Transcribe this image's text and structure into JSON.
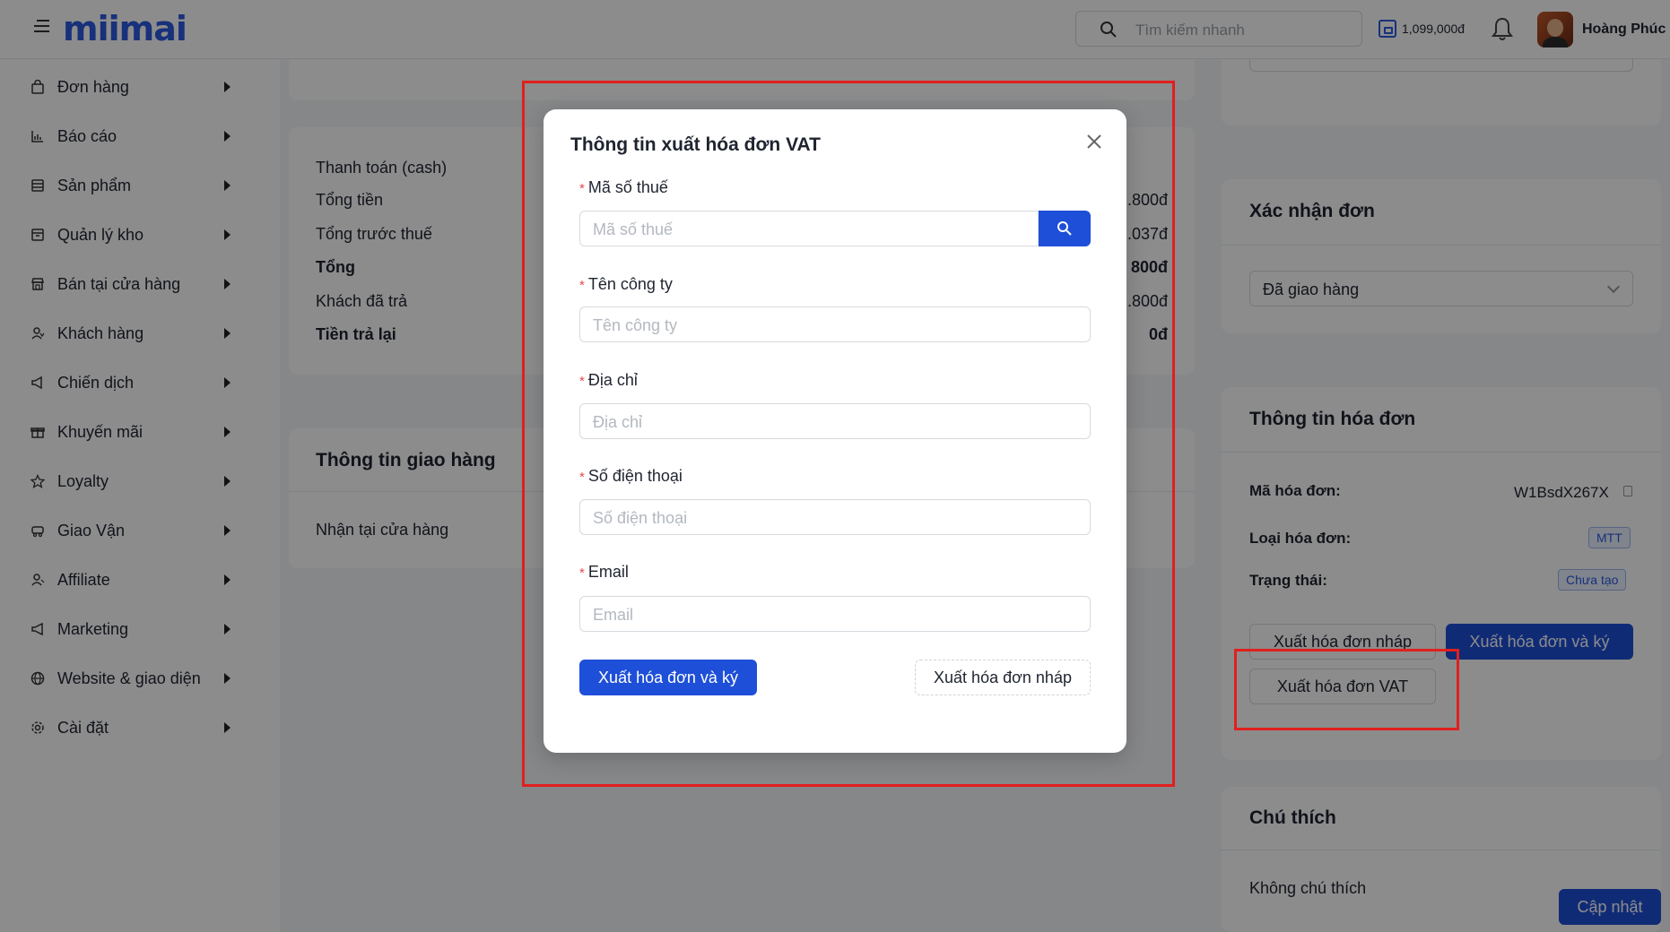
{
  "header": {
    "logo": "miimai",
    "search_placeholder": "Tìm kiếm nhanh",
    "balance": "1,099,000đ",
    "user_name": "Hoàng Phúc"
  },
  "sidebar": {
    "items": [
      {
        "label": "Đơn hàng",
        "icon": "bag-icon"
      },
      {
        "label": "Báo cáo",
        "icon": "chart-icon"
      },
      {
        "label": "Sản phẩm",
        "icon": "box-icon"
      },
      {
        "label": "Quản lý kho",
        "icon": "warehouse-icon"
      },
      {
        "label": "Bán tại cửa hàng",
        "icon": "store-icon"
      },
      {
        "label": "Khách hàng",
        "icon": "customer-icon"
      },
      {
        "label": "Chiến dịch",
        "icon": "megaphone-icon"
      },
      {
        "label": "Khuyến mãi",
        "icon": "gift-icon"
      },
      {
        "label": "Loyalty",
        "icon": "star-icon"
      },
      {
        "label": "Giao Vận",
        "icon": "truck-icon"
      },
      {
        "label": "Affiliate",
        "icon": "affiliate-icon"
      },
      {
        "label": "Marketing",
        "icon": "marketing-icon"
      },
      {
        "label": "Website & giao diện",
        "icon": "globe-icon"
      },
      {
        "label": "Cài đặt",
        "icon": "gear-icon"
      }
    ]
  },
  "payment": {
    "rows": [
      {
        "label": "Thanh toán (cash)",
        "value": "",
        "bold": false
      },
      {
        "label": "Tổng tiền",
        "value": ".800đ",
        "bold": false
      },
      {
        "label": "Tổng trước thuế",
        "value": ".037đ",
        "bold": false
      },
      {
        "label": "Tổng",
        "value": "800đ",
        "bold": true
      },
      {
        "label": "Khách đã trả",
        "value": ".800đ",
        "bold": false
      },
      {
        "label": "Tiền trả lại",
        "value": "0đ",
        "bold": true
      }
    ]
  },
  "shipping": {
    "title": "Thông tin giao hàng",
    "method": "Nhận tại cửa hàng"
  },
  "confirm": {
    "title": "Xác nhận đơn",
    "status_value": "Đã giao hàng"
  },
  "invoice": {
    "title": "Thông tin hóa đơn",
    "code_label": "Mã hóa đơn:",
    "code_value": "W1BsdX267X",
    "type_label": "Loại hóa đơn:",
    "type_value": "MTT",
    "status_label": "Trạng thái:",
    "status_value": "Chưa tạo",
    "btn_draft": "Xuất hóa đơn nháp",
    "btn_sign": "Xuất hóa đơn và ký",
    "btn_vat": "Xuất hóa đơn VAT"
  },
  "note": {
    "title": "Chú thích",
    "text": "Không chú thích",
    "update_btn": "Cập nhật"
  },
  "modal": {
    "title": "Thông tin xuất hóa đơn VAT",
    "fields": [
      {
        "label": "Mã số thuế",
        "placeholder": "Mã số thuế"
      },
      {
        "label": "Tên công ty",
        "placeholder": "Tên công ty"
      },
      {
        "label": "Địa chỉ",
        "placeholder": "Địa chỉ"
      },
      {
        "label": "Số điện thoại",
        "placeholder": "Số điện thoại"
      },
      {
        "label": "Email",
        "placeholder": "Email"
      }
    ],
    "btn_sign": "Xuất hóa đơn và ký",
    "btn_draft": "Xuất hóa đơn nháp"
  },
  "colors": {
    "primary": "#1e4fd8",
    "highlight": "#e0201e",
    "required": "#e5484d"
  }
}
